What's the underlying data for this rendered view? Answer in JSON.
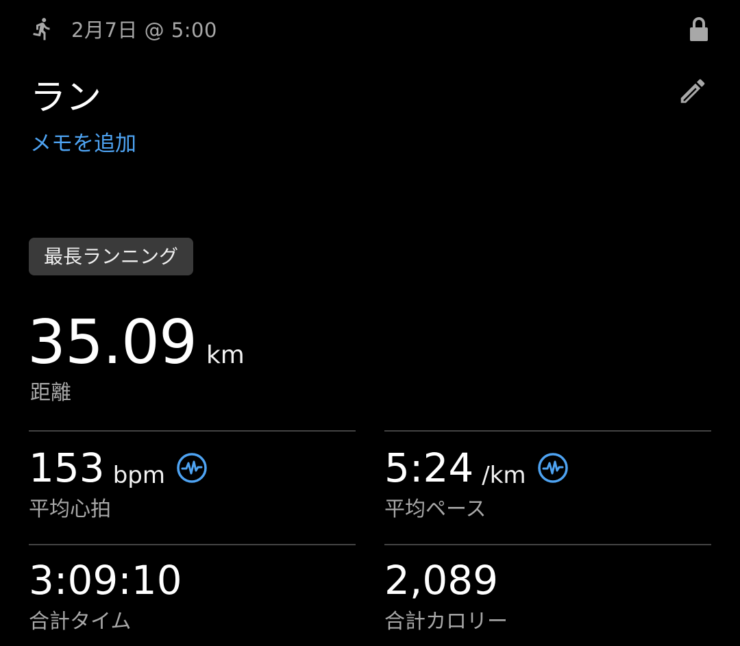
{
  "header": {
    "activity_icon": "running-person-icon",
    "date_time": "2月7日 @ 5:00",
    "lock_icon": "lock-icon"
  },
  "activity": {
    "title": "ラン",
    "edit_icon": "pencil-icon",
    "add_memo_label": "メモを追加",
    "record_badge": "最長ランニング"
  },
  "distance": {
    "value": "35.09",
    "unit": "km",
    "label": "距離"
  },
  "stats": [
    {
      "value": "153",
      "unit": "bpm",
      "label": "平均心拍",
      "icon": "pulse-chart-icon"
    },
    {
      "value": "5:24",
      "unit": "/km",
      "label": "平均ペース",
      "icon": "pulse-chart-icon"
    },
    {
      "value": "3:09:10",
      "unit": "",
      "label": "合計タイム"
    },
    {
      "value": "2,089",
      "unit": "",
      "label": "合計カロリー"
    }
  ],
  "colors": {
    "background": "#000000",
    "accent": "#4ea3f2",
    "secondary_text": "#a8a8a8",
    "badge_bg": "#3a3a3a",
    "divider": "#444444"
  }
}
